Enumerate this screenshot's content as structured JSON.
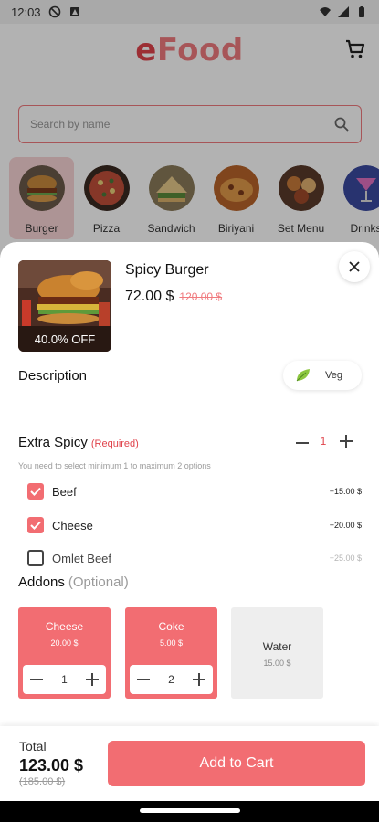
{
  "status_bar": {
    "time": "12:03"
  },
  "app": {
    "logo_part1": "e",
    "logo_part2": "Food"
  },
  "search": {
    "placeholder": "Search by name"
  },
  "categories": [
    {
      "label": "Burger",
      "active": true
    },
    {
      "label": "Pizza"
    },
    {
      "label": "Sandwich"
    },
    {
      "label": "Biriyani"
    },
    {
      "label": "Set Menu"
    },
    {
      "label": "Drinks"
    }
  ],
  "product": {
    "title": "Spicy Burger",
    "price": "72.00 $",
    "old_price": "120.00 $",
    "discount_badge": "40.0% OFF"
  },
  "description": {
    "title": "Description",
    "veg_label": "Veg"
  },
  "extra": {
    "title": "Extra Spicy",
    "required_label": "(Required)",
    "quantity": "1",
    "hint": "You need to select minimum 1 to maximum 2 options",
    "options": [
      {
        "name": "Beef",
        "price": "+15.00 $",
        "checked": true
      },
      {
        "name": "Cheese",
        "price": "+20.00 $",
        "checked": true
      },
      {
        "name": "Omlet Beef",
        "price": "+25.00 $",
        "checked": false
      }
    ]
  },
  "addons": {
    "title": "Addons",
    "optional_label": "(Optional)",
    "items": [
      {
        "name": "Cheese",
        "price": "20.00 $",
        "qty": "1",
        "selected": true
      },
      {
        "name": "Coke",
        "price": "5.00 $",
        "qty": "2",
        "selected": true
      },
      {
        "name": "Water",
        "price": "15.00 $",
        "selected": false
      }
    ]
  },
  "footer": {
    "total_label": "Total",
    "total": "123.00 $",
    "old_total": "(185.00 $)",
    "add_to_cart": "Add to Cart"
  },
  "colors": {
    "accent": "#f26d72",
    "brand_red": "#e0434b",
    "brand_light": "#f07a7e"
  },
  "icons": [
    "do-not-disturb-icon",
    "app-icon",
    "wifi-icon",
    "battery-icon",
    "cart-icon",
    "search-icon",
    "close-icon",
    "leaf-icon",
    "minus-icon",
    "plus-icon",
    "check-icon"
  ]
}
